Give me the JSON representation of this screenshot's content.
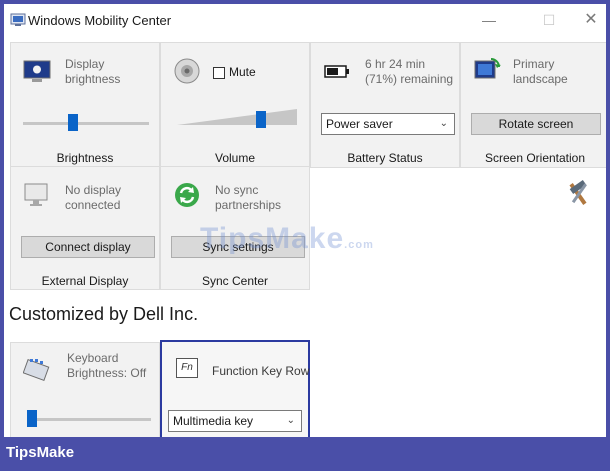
{
  "window": {
    "title": "Windows Mobility Center"
  },
  "tiles": {
    "brightness": {
      "desc": "Display brightness",
      "label": "Brightness",
      "level": 0.3
    },
    "volume": {
      "mute_label": "Mute",
      "label": "Volume",
      "level": 0.7
    },
    "battery": {
      "desc": "6 hr 24 min (71%) remaining",
      "plan": "Power saver",
      "label": "Battery Status"
    },
    "orientation": {
      "desc": "Primary landscape",
      "button": "Rotate screen",
      "label": "Screen Orientation"
    },
    "external": {
      "desc": "No display connected",
      "button": "Connect display",
      "label": "External Display"
    },
    "sync": {
      "desc": "No sync partnerships",
      "button": "Sync settings",
      "label": "Sync Center"
    },
    "keyboard": {
      "desc": "Keyboard Brightness: Off",
      "level": 0.0
    },
    "fnrow": {
      "key_cap": "Fn",
      "desc": "Function Key Row",
      "option": "Multimedia key"
    }
  },
  "section": {
    "title": "Customized by Dell Inc."
  },
  "watermark": {
    "text": "TipsMake",
    "suffix": ".com"
  },
  "footer": {
    "brand": "TipsMake"
  },
  "colors": {
    "accent": "#0a64c8",
    "brand": "#4a4fa8",
    "selected_border": "#2b3aa0"
  }
}
